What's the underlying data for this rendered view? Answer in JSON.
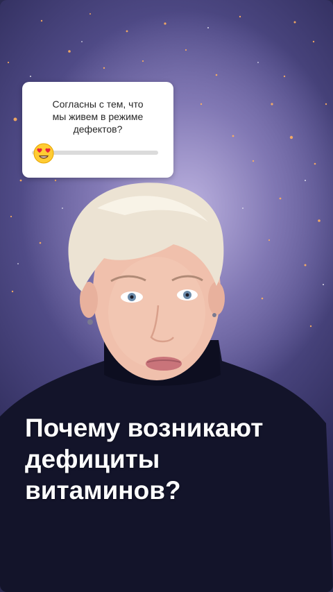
{
  "poll": {
    "question_lines": [
      "Согласны с тем, что",
      "мы живем в режиме",
      "дефектов?"
    ],
    "emoji": "heart-eyes-emoji",
    "slider_value": 0.08
  },
  "headline": {
    "lines": [
      "Почему возникают",
      "дефициты",
      "витаминов?"
    ]
  },
  "colors": {
    "headline_text": "#ffffff",
    "card_bg": "#ffffff",
    "track": "#dbdbdb",
    "sweater": "#13142a"
  }
}
